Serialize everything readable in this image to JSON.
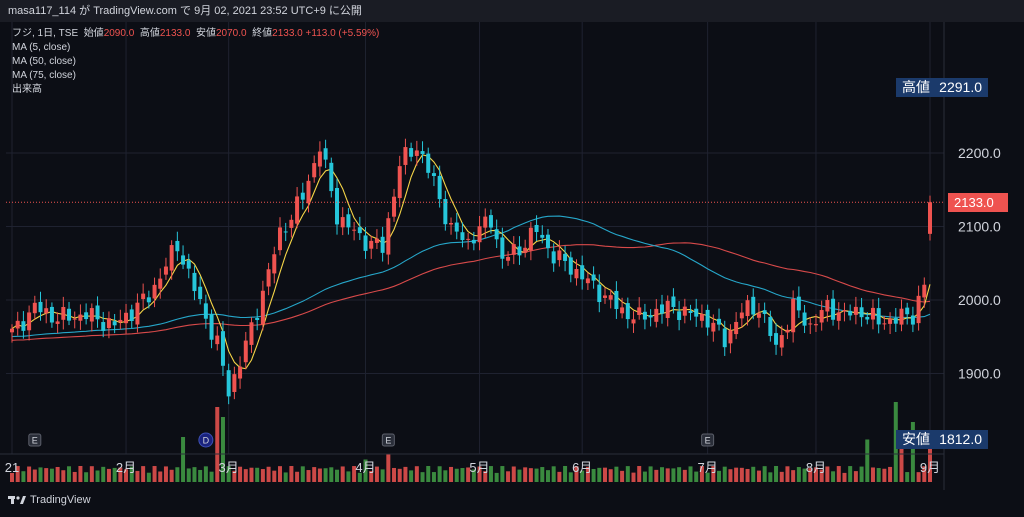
{
  "header": {
    "text": "masa117_114 が TradingView.com で 9月 02, 2021 23:52 UTC+9 に公開"
  },
  "legend": {
    "symbol": "フジ, 1日, TSE",
    "o_label": "始値",
    "o": "2090.0",
    "h_label": "高値",
    "h": "2133.0",
    "l_label": "安値",
    "l": "2070.0",
    "c_label": "終値",
    "c": "2133.0",
    "change": "+113.0 (+5.59%)",
    "ma1": "MA (5, close)",
    "ma2": "MA (50, close)",
    "ma3": "MA (75, close)",
    "vol": "出来高"
  },
  "price_tags": {
    "high_label": "高値",
    "high_value": "2291.0",
    "last_value": "2133.0",
    "low_label": "安値",
    "low_value": "1812.0"
  },
  "footer": {
    "brand": "TradingView"
  },
  "colors": {
    "up": "#ef5350",
    "down": "#26c6da",
    "vol_up": "#ef5350",
    "vol_down": "#43a047",
    "ma5": "#f5d547",
    "ma50": "#26a6c9",
    "ma75": "#d84a4a",
    "bg": "#0c0e15"
  },
  "chart_data": {
    "type": "candlestick",
    "ylim": [
      1800,
      2300
    ],
    "y_ticks": [
      "1900.0",
      "2000.0",
      "2100.0",
      "2200.0"
    ],
    "x_labels": [
      "21",
      "2月",
      "3月",
      "4月",
      "5月",
      "6月",
      "7月",
      "8月",
      "9月"
    ],
    "x_label_index": [
      0,
      20,
      38,
      62,
      82,
      100,
      122,
      141,
      161
    ],
    "events": [
      {
        "label": "E",
        "index": 4
      },
      {
        "label": "D",
        "index": 34
      },
      {
        "label": "E",
        "index": 66
      },
      {
        "label": "E",
        "index": 122
      },
      {
        "label": "E",
        "index": 158
      }
    ],
    "pivot_prices": [
      [
        0,
        1955
      ],
      [
        4,
        1990
      ],
      [
        8,
        1975
      ],
      [
        13,
        1980
      ],
      [
        18,
        1965
      ],
      [
        24,
        2005
      ],
      [
        29,
        2075
      ],
      [
        33,
        1995
      ],
      [
        36,
        1940
      ],
      [
        38,
        1875
      ],
      [
        42,
        1960
      ],
      [
        47,
        2090
      ],
      [
        51,
        2140
      ],
      [
        54,
        2210
      ],
      [
        57,
        2115
      ],
      [
        61,
        2085
      ],
      [
        65,
        2070
      ],
      [
        68,
        2185
      ],
      [
        71,
        2210
      ],
      [
        74,
        2160
      ],
      [
        77,
        2095
      ],
      [
        80,
        2080
      ],
      [
        84,
        2110
      ],
      [
        86,
        2055
      ],
      [
        89,
        2070
      ],
      [
        92,
        2095
      ],
      [
        95,
        2060
      ],
      [
        98,
        2045
      ],
      [
        101,
        2025
      ],
      [
        104,
        2005
      ],
      [
        107,
        1985
      ],
      [
        110,
        1975
      ],
      [
        113,
        1985
      ],
      [
        116,
        1990
      ],
      [
        119,
        1980
      ],
      [
        122,
        1975
      ],
      [
        125,
        1945
      ],
      [
        128,
        1985
      ],
      [
        131,
        1990
      ],
      [
        134,
        1935
      ],
      [
        137,
        1990
      ],
      [
        140,
        1965
      ],
      [
        143,
        1990
      ],
      [
        146,
        1980
      ],
      [
        149,
        1985
      ],
      [
        152,
        1970
      ],
      [
        155,
        1975
      ],
      [
        158,
        1980
      ],
      [
        160,
        2020
      ],
      [
        161,
        2133
      ]
    ],
    "volume_max": 180000,
    "volume_spikes": [
      [
        30,
        90000
      ],
      [
        36,
        150000
      ],
      [
        37,
        130000
      ],
      [
        62,
        45000
      ],
      [
        66,
        55000
      ],
      [
        150,
        85000
      ],
      [
        155,
        160000
      ],
      [
        156,
        90000
      ],
      [
        158,
        120000
      ],
      [
        161,
        95000
      ]
    ],
    "high": 2291.0,
    "low": 1812.0,
    "last": 2133.0
  }
}
